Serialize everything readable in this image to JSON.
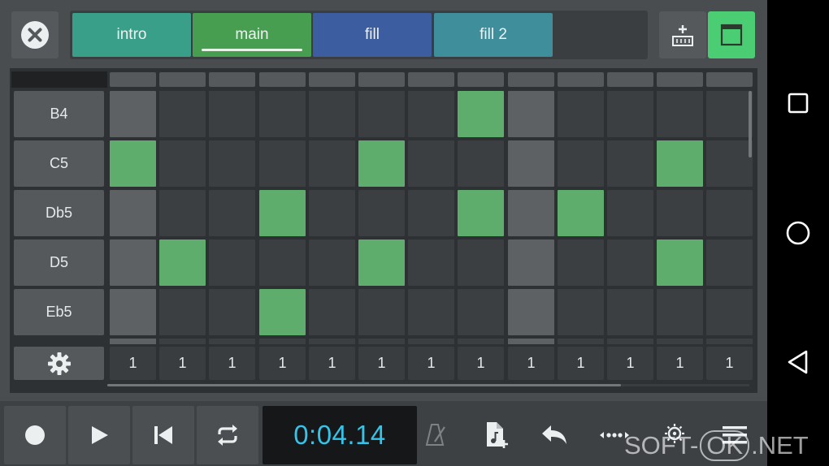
{
  "app": {
    "view_mode": "step-sequencer",
    "accent_color": "#4bce73",
    "active_cell_color": "#5fad6c"
  },
  "header": {
    "close_icon": "close-icon",
    "add_pattern_icon": "add-pattern-icon",
    "view_icon": "grid-view-icon",
    "patterns": [
      {
        "label": "intro",
        "color": "#3a9f89",
        "active": false
      },
      {
        "label": "main",
        "color": "#479e50",
        "active": true
      },
      {
        "label": "fill",
        "color": "#3c5ea0",
        "active": false
      },
      {
        "label": "fill 2",
        "color": "#3f8e9b",
        "active": false
      }
    ]
  },
  "grid": {
    "notes": [
      "B4",
      "C5",
      "Db5",
      "D5",
      "Eb5"
    ],
    "beat_columns": [
      0,
      8
    ],
    "velocities": [
      "1",
      "1",
      "1",
      "1",
      "1",
      "1",
      "1",
      "1",
      "1",
      "1",
      "1",
      "1",
      "1"
    ],
    "steps": [
      [
        0,
        0,
        0,
        0,
        0,
        0,
        0,
        1,
        0,
        0,
        0,
        0,
        0
      ],
      [
        1,
        0,
        0,
        0,
        0,
        1,
        0,
        0,
        0,
        0,
        0,
        1,
        0
      ],
      [
        0,
        0,
        0,
        1,
        0,
        0,
        0,
        1,
        0,
        1,
        0,
        0,
        0
      ],
      [
        0,
        1,
        0,
        0,
        0,
        1,
        0,
        0,
        0,
        0,
        0,
        1,
        0
      ],
      [
        0,
        0,
        0,
        1,
        0,
        0,
        0,
        0,
        0,
        0,
        0,
        0,
        0
      ]
    ],
    "settings_icon": "gear-icon"
  },
  "transport": {
    "time": "0:04.14",
    "record_icon": "record-icon",
    "play_icon": "play-icon",
    "rewind_icon": "skip-to-start-icon",
    "loop_icon": "loop-icon",
    "metronome_icon": "metronome-icon",
    "new_file_icon": "new-file-icon",
    "undo_icon": "undo-icon",
    "more_icon": "more-icon",
    "fx_icon": "fx-icon",
    "menu_icon": "menu-icon"
  },
  "android_nav": {
    "recents_icon": "recents-square-icon",
    "home_icon": "home-circle-icon",
    "back_icon": "back-triangle-icon"
  },
  "watermark": {
    "left": "SOFT-",
    "mid": "OK",
    "right": ".NET"
  }
}
